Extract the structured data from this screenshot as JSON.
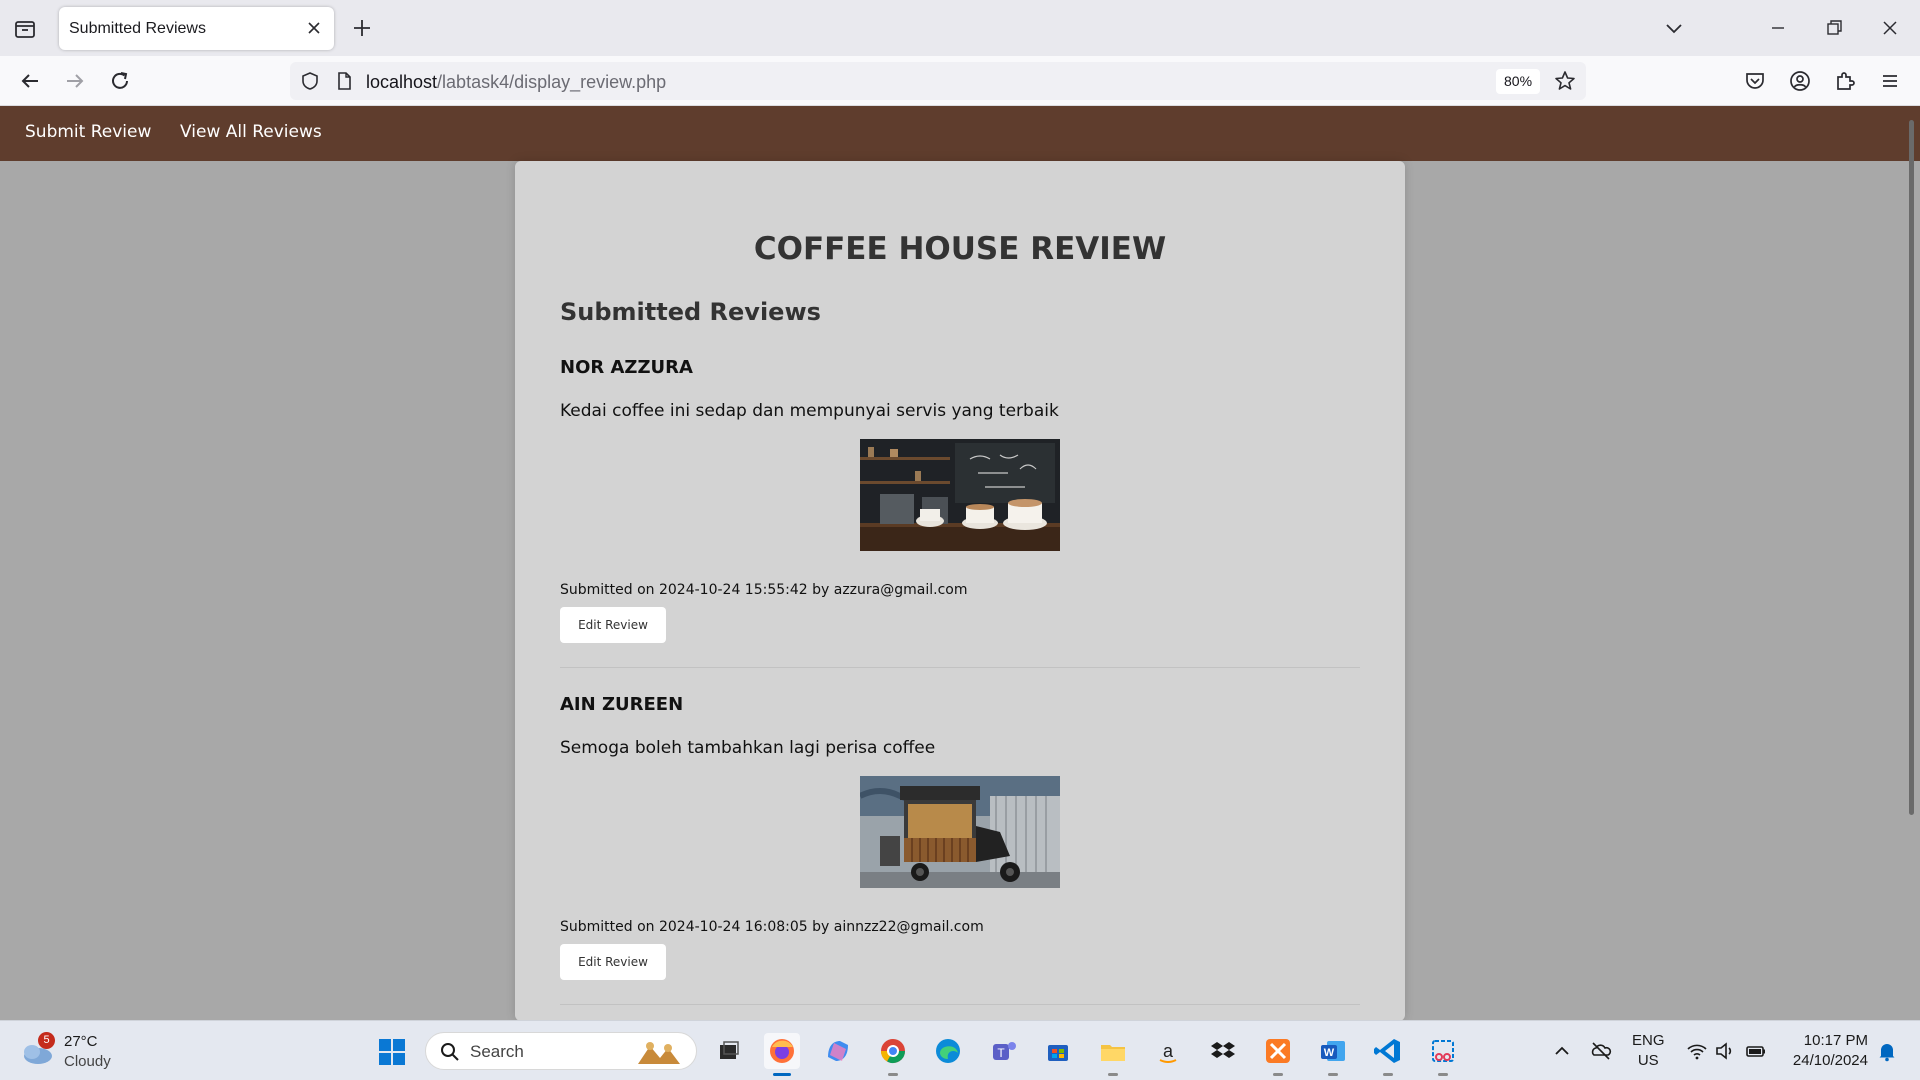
{
  "browser": {
    "tab_title": "Submitted Reviews",
    "url_host": "localhost",
    "url_path": "/labtask4/display_review.php",
    "zoom": "80%"
  },
  "site_nav": {
    "items": [
      {
        "label": "Submit Review"
      },
      {
        "label": "View All Reviews"
      }
    ]
  },
  "page": {
    "title": "COFFEE HOUSE REVIEW",
    "section_title": "Submitted Reviews",
    "reviews": [
      {
        "name": "NOR AZZURA",
        "text": "Kedai coffee ini sedap dan mempunyai servis yang terbaik",
        "submitted_prefix": "Submitted on 2024-10-24 15:55:42 by azzura@gmail.com",
        "edit_label": "Edit Review",
        "image": "coffee-bar-photo"
      },
      {
        "name": "AIN ZUREEN",
        "text": "Semoga boleh tambahkan lagi perisa coffee",
        "submitted_prefix": "Submitted on 2024-10-24 16:08:05 by ainnzz22@gmail.com",
        "edit_label": "Edit Review",
        "image": "coffee-cart-photo"
      }
    ]
  },
  "taskbar": {
    "weather_badge": "5",
    "weather_temp": "27°C",
    "weather_cond": "Cloudy",
    "search_label": "Search",
    "lang_line1": "ENG",
    "lang_line2": "US",
    "time": "10:17 PM",
    "date": "24/10/2024"
  },
  "colors": {
    "nav_brown": "#5f3d2d",
    "card_bg": "#d3d3d3",
    "page_bg": "#a8a8a8"
  }
}
